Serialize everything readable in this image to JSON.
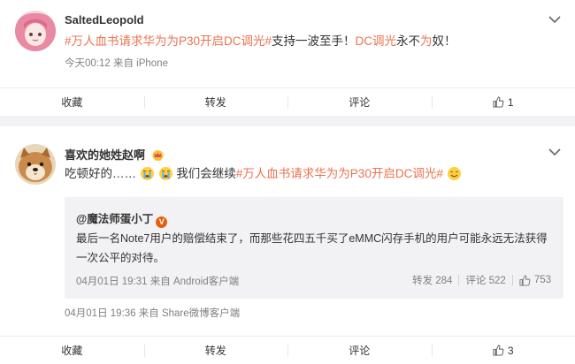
{
  "post1": {
    "username": "SaltedLeopold",
    "content": {
      "topic": "#万人血书请求华为为P30开启DC调光#",
      "text1": "支持一波至手！",
      "kw1": "DC调光",
      "text2": "永不",
      "kw2": "为",
      "text3": "奴！"
    },
    "meta": "今天00:12 来自 iPhone",
    "actions": {
      "collect": "收藏",
      "repost": "转发",
      "comment": "评论",
      "like_count": "1"
    }
  },
  "post2": {
    "username": "喜欢的她姓赵啊",
    "content": {
      "text1": "吃顿好的……",
      "text2": "我们会继续",
      "topic": "#万人血书请求华为为P30开启DC调光#"
    },
    "repost": {
      "user": "@魔法师蛋小丁",
      "badge": "V",
      "text": "最后一名Note7用户的赔偿结束了，而那些花四五千买了eMMC闪存手机的用户可能永远无法获得一次公平的对待。",
      "meta": "04月01日 19:31 来自 Android客户端",
      "repost_label": "转发 284",
      "comment_label": "评论 522",
      "like_count": "753"
    },
    "meta": "04月01日 19:36 来自 Share微博客户端",
    "actions": {
      "collect": "收藏",
      "repost": "转发",
      "comment": "评论",
      "like_count": "3"
    }
  },
  "colors": {
    "topic": "#eb7350",
    "meta": "#808080",
    "background": "#f2f2f5"
  }
}
